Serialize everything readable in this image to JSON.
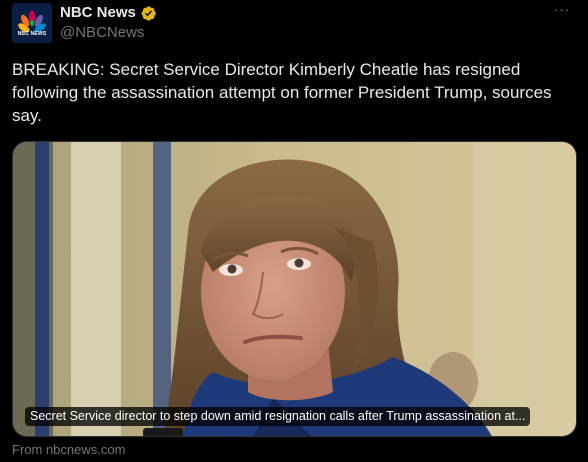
{
  "author": {
    "display_name": "NBC News",
    "handle": "@NBCNews",
    "avatar_text": "NBC NEWS",
    "verified": true
  },
  "more_label": "···",
  "tweet": {
    "text": "BREAKING: Secret Service Director Kimberly Cheatle has resigned following the assassination attempt on former President Trump, sources say."
  },
  "card": {
    "caption": "Secret Service director to step down amid resignation calls after Trump assassination at...",
    "source": "From nbcnews.com"
  },
  "colors": {
    "background": "#000000",
    "primary_text": "#e7e9ea",
    "secondary_text": "#71767b",
    "verified_gold": "#e2b719",
    "border": "#2f3336"
  },
  "icons": {
    "verified": "gold-checkmark-badge",
    "more": "three-dots-horizontal",
    "logo": "nbc-peacock"
  }
}
